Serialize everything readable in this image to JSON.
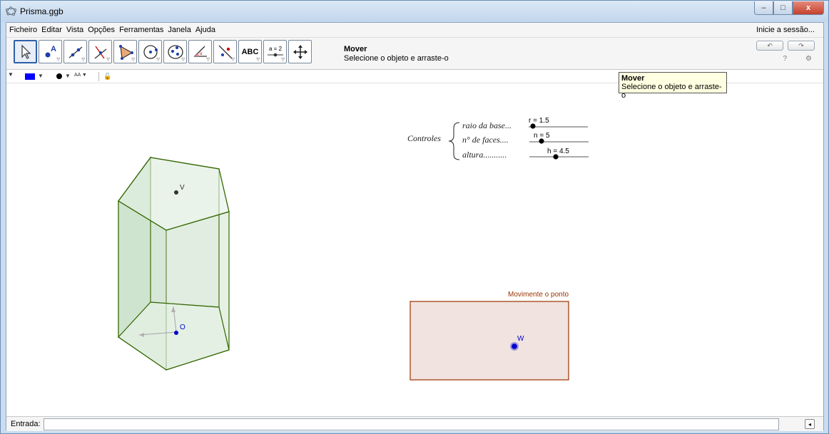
{
  "window": {
    "title": "Prisma.ggb",
    "minimize": "–",
    "maximize": "□",
    "close": "x"
  },
  "menu": {
    "items": [
      "Ficheiro",
      "Editar",
      "Vista",
      "Opções",
      "Ferramentas",
      "Janela",
      "Ajuda"
    ],
    "login": "Inicie a sessão..."
  },
  "toolbar": {
    "tools": [
      {
        "name": "move",
        "icon": "pointer-arrow-icon"
      },
      {
        "name": "point",
        "icon": "point-icon"
      },
      {
        "name": "line",
        "icon": "line-icon"
      },
      {
        "name": "perpendicular",
        "icon": "perpendicular-line-icon"
      },
      {
        "name": "polygon",
        "icon": "polygon-icon"
      },
      {
        "name": "circle",
        "icon": "circle-center-icon"
      },
      {
        "name": "ellipse",
        "icon": "ellipse-icon"
      },
      {
        "name": "angle",
        "icon": "angle-icon"
      },
      {
        "name": "reflect",
        "icon": "reflect-icon"
      },
      {
        "name": "text",
        "icon": "text-abc-icon",
        "label": "ABC"
      },
      {
        "name": "slider",
        "icon": "slider-icon",
        "label": "a = 2"
      },
      {
        "name": "move-view",
        "icon": "move-graphics-view-icon"
      }
    ],
    "active_tool_name": "Mover",
    "active_tool_help": "Selecione o objeto e arraste-o",
    "undo": "↶",
    "redo": "↷",
    "help": "?",
    "settings": "⚙"
  },
  "tooltip": {
    "title": "Mover",
    "text": "Selecione o objeto e arraste-o"
  },
  "graphics": {
    "controls_label": "Controles",
    "sliders": [
      {
        "caption": "raio da base...",
        "label": "r = 1.5",
        "value": 1.5,
        "fraction": 0.07
      },
      {
        "caption": "n° de faces....",
        "label": "n = 5",
        "value": 5,
        "fraction": 0.18
      },
      {
        "caption": "altura...........",
        "label": "h = 4.5",
        "value": 4.5,
        "fraction": 0.45
      }
    ],
    "point_v": "V",
    "point_o": "O",
    "point_w": "W",
    "box_title": "Movimente o ponto",
    "colors": {
      "prism_edge": "#336600",
      "prism_fill": "#cfe3cf",
      "point_blue": "#0000cc",
      "box_fill": "#f1e3df",
      "box_border": "#993300"
    }
  },
  "input": {
    "label": "Entrada:",
    "value": ""
  }
}
